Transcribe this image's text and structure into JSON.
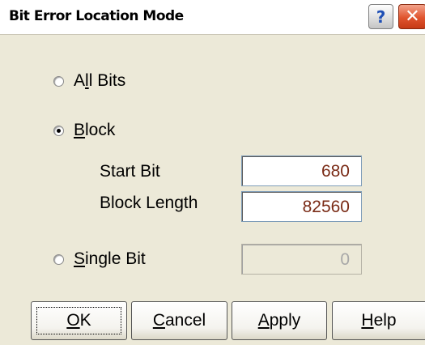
{
  "window": {
    "title": "Bit Error Location Mode",
    "help_glyph": "?",
    "close_glyph": "✕"
  },
  "options": {
    "all_bits": {
      "label_pre": "A",
      "label_u": "l",
      "label_post": "l Bits",
      "selected": false
    },
    "block": {
      "label_pre": "",
      "label_u": "B",
      "label_post": "lock",
      "selected": true
    },
    "single_bit": {
      "label_pre": "",
      "label_u": "S",
      "label_post": "ingle Bit",
      "selected": false
    }
  },
  "block_fields": {
    "start_bit_label": "Start Bit",
    "start_bit_value": "680",
    "block_length_label": "Block Length",
    "block_length_value": "82560"
  },
  "single_bit_value": "0",
  "buttons": {
    "ok": {
      "u": "O",
      "rest": "K"
    },
    "cancel": {
      "u": "C",
      "rest": "ancel"
    },
    "apply": {
      "u": "A",
      "rest": "pply"
    },
    "help": {
      "u": "H",
      "rest": "elp"
    }
  }
}
